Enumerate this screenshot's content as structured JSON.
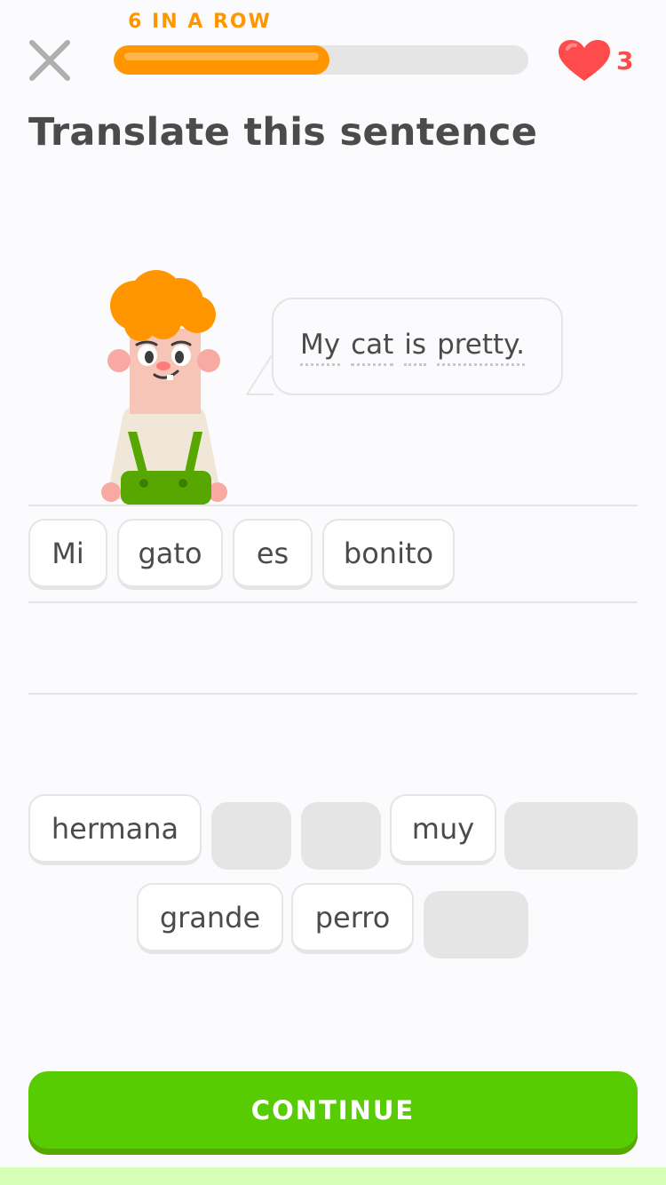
{
  "header": {
    "close_icon": "close-x-icon",
    "streak_label": "6 IN A ROW",
    "progress": 0.52,
    "progress_color": "#ff9600",
    "hearts_icon": "heart-icon",
    "hearts_count": "3",
    "hearts_color": "#ff4b4b"
  },
  "prompt": {
    "title": "Translate this sentence"
  },
  "bubble": {
    "words": [
      "My",
      "cat",
      "is",
      "pretty."
    ]
  },
  "answer": {
    "chips": [
      "Mi",
      "gato",
      "es",
      "bonito"
    ]
  },
  "word_bank": {
    "chips": [
      {
        "label": "hermana",
        "used": false
      },
      {
        "label": "",
        "used": true
      },
      {
        "label": "",
        "used": true
      },
      {
        "label": "muy",
        "used": false
      },
      {
        "label": "",
        "used": true
      },
      {
        "label": "grande",
        "used": false
      },
      {
        "label": "perro",
        "used": false
      },
      {
        "label": "",
        "used": true
      }
    ]
  },
  "footer": {
    "continue_label": "CONTINUE",
    "continue_color": "#58cc02"
  }
}
